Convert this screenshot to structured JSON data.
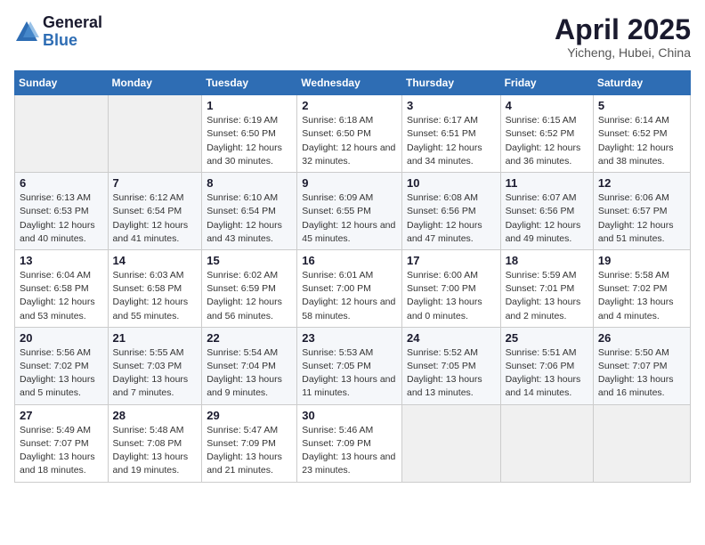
{
  "logo": {
    "general": "General",
    "blue": "Blue"
  },
  "title": "April 2025",
  "subtitle": "Yicheng, Hubei, China",
  "days_header": [
    "Sunday",
    "Monday",
    "Tuesday",
    "Wednesday",
    "Thursday",
    "Friday",
    "Saturday"
  ],
  "weeks": [
    [
      {
        "num": "",
        "detail": ""
      },
      {
        "num": "",
        "detail": ""
      },
      {
        "num": "1",
        "detail": "Sunrise: 6:19 AM\nSunset: 6:50 PM\nDaylight: 12 hours and 30 minutes."
      },
      {
        "num": "2",
        "detail": "Sunrise: 6:18 AM\nSunset: 6:50 PM\nDaylight: 12 hours and 32 minutes."
      },
      {
        "num": "3",
        "detail": "Sunrise: 6:17 AM\nSunset: 6:51 PM\nDaylight: 12 hours and 34 minutes."
      },
      {
        "num": "4",
        "detail": "Sunrise: 6:15 AM\nSunset: 6:52 PM\nDaylight: 12 hours and 36 minutes."
      },
      {
        "num": "5",
        "detail": "Sunrise: 6:14 AM\nSunset: 6:52 PM\nDaylight: 12 hours and 38 minutes."
      }
    ],
    [
      {
        "num": "6",
        "detail": "Sunrise: 6:13 AM\nSunset: 6:53 PM\nDaylight: 12 hours and 40 minutes."
      },
      {
        "num": "7",
        "detail": "Sunrise: 6:12 AM\nSunset: 6:54 PM\nDaylight: 12 hours and 41 minutes."
      },
      {
        "num": "8",
        "detail": "Sunrise: 6:10 AM\nSunset: 6:54 PM\nDaylight: 12 hours and 43 minutes."
      },
      {
        "num": "9",
        "detail": "Sunrise: 6:09 AM\nSunset: 6:55 PM\nDaylight: 12 hours and 45 minutes."
      },
      {
        "num": "10",
        "detail": "Sunrise: 6:08 AM\nSunset: 6:56 PM\nDaylight: 12 hours and 47 minutes."
      },
      {
        "num": "11",
        "detail": "Sunrise: 6:07 AM\nSunset: 6:56 PM\nDaylight: 12 hours and 49 minutes."
      },
      {
        "num": "12",
        "detail": "Sunrise: 6:06 AM\nSunset: 6:57 PM\nDaylight: 12 hours and 51 minutes."
      }
    ],
    [
      {
        "num": "13",
        "detail": "Sunrise: 6:04 AM\nSunset: 6:58 PM\nDaylight: 12 hours and 53 minutes."
      },
      {
        "num": "14",
        "detail": "Sunrise: 6:03 AM\nSunset: 6:58 PM\nDaylight: 12 hours and 55 minutes."
      },
      {
        "num": "15",
        "detail": "Sunrise: 6:02 AM\nSunset: 6:59 PM\nDaylight: 12 hours and 56 minutes."
      },
      {
        "num": "16",
        "detail": "Sunrise: 6:01 AM\nSunset: 7:00 PM\nDaylight: 12 hours and 58 minutes."
      },
      {
        "num": "17",
        "detail": "Sunrise: 6:00 AM\nSunset: 7:00 PM\nDaylight: 13 hours and 0 minutes."
      },
      {
        "num": "18",
        "detail": "Sunrise: 5:59 AM\nSunset: 7:01 PM\nDaylight: 13 hours and 2 minutes."
      },
      {
        "num": "19",
        "detail": "Sunrise: 5:58 AM\nSunset: 7:02 PM\nDaylight: 13 hours and 4 minutes."
      }
    ],
    [
      {
        "num": "20",
        "detail": "Sunrise: 5:56 AM\nSunset: 7:02 PM\nDaylight: 13 hours and 5 minutes."
      },
      {
        "num": "21",
        "detail": "Sunrise: 5:55 AM\nSunset: 7:03 PM\nDaylight: 13 hours and 7 minutes."
      },
      {
        "num": "22",
        "detail": "Sunrise: 5:54 AM\nSunset: 7:04 PM\nDaylight: 13 hours and 9 minutes."
      },
      {
        "num": "23",
        "detail": "Sunrise: 5:53 AM\nSunset: 7:05 PM\nDaylight: 13 hours and 11 minutes."
      },
      {
        "num": "24",
        "detail": "Sunrise: 5:52 AM\nSunset: 7:05 PM\nDaylight: 13 hours and 13 minutes."
      },
      {
        "num": "25",
        "detail": "Sunrise: 5:51 AM\nSunset: 7:06 PM\nDaylight: 13 hours and 14 minutes."
      },
      {
        "num": "26",
        "detail": "Sunrise: 5:50 AM\nSunset: 7:07 PM\nDaylight: 13 hours and 16 minutes."
      }
    ],
    [
      {
        "num": "27",
        "detail": "Sunrise: 5:49 AM\nSunset: 7:07 PM\nDaylight: 13 hours and 18 minutes."
      },
      {
        "num": "28",
        "detail": "Sunrise: 5:48 AM\nSunset: 7:08 PM\nDaylight: 13 hours and 19 minutes."
      },
      {
        "num": "29",
        "detail": "Sunrise: 5:47 AM\nSunset: 7:09 PM\nDaylight: 13 hours and 21 minutes."
      },
      {
        "num": "30",
        "detail": "Sunrise: 5:46 AM\nSunset: 7:09 PM\nDaylight: 13 hours and 23 minutes."
      },
      {
        "num": "",
        "detail": ""
      },
      {
        "num": "",
        "detail": ""
      },
      {
        "num": "",
        "detail": ""
      }
    ]
  ]
}
